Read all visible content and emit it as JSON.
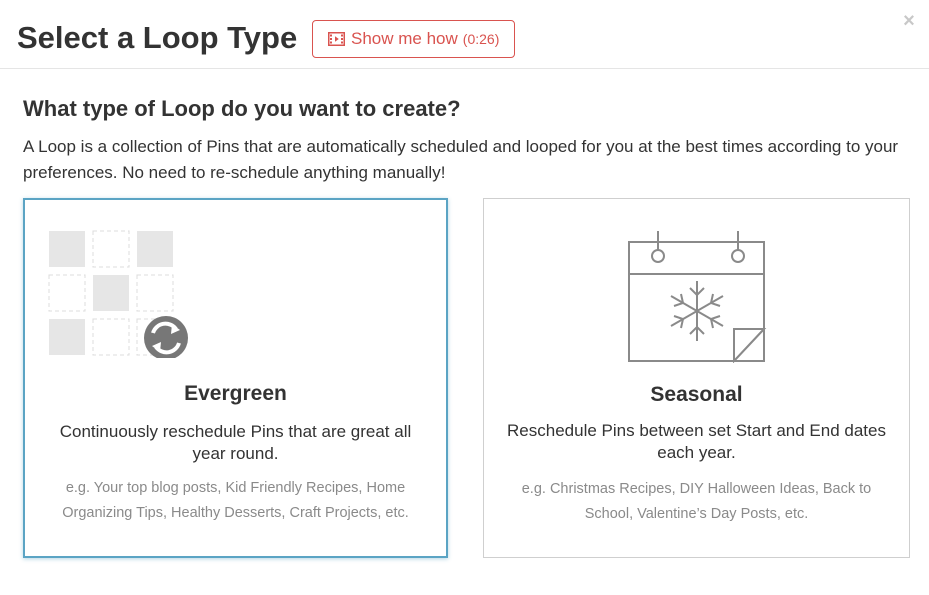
{
  "header": {
    "title": "Select a Loop Type",
    "show_me_how_label": "Show me how",
    "show_me_how_duration": "(0:26)",
    "close_label": "×"
  },
  "intro": {
    "question": "What type of Loop do you want to create?",
    "description": "A Loop is a collection of Pins that are automatically scheduled and looped for you at the best times according to your preferences. No need to re-schedule anything manually!"
  },
  "cards": [
    {
      "name": "Evergreen",
      "subtitle": "Continuously reschedule Pins that are great all year round.",
      "examples": "e.g. Your top blog posts, Kid Friendly Recipes, Home Organizing Tips, Healthy Desserts, Craft Projects, etc.",
      "icon": "evergreen-grid-refresh-icon",
      "selected": true
    },
    {
      "name": "Seasonal",
      "subtitle": "Reschedule Pins between set Start and End dates each year.",
      "examples": "e.g. Christmas Recipes, DIY Halloween Ideas, Back to School, Valentine’s Day Posts, etc.",
      "icon": "calendar-snowflake-icon",
      "selected": false
    }
  ],
  "colors": {
    "accent_red": "#d9534f",
    "selected_border": "#5ba4c4",
    "muted_text": "#8a8a8a"
  }
}
